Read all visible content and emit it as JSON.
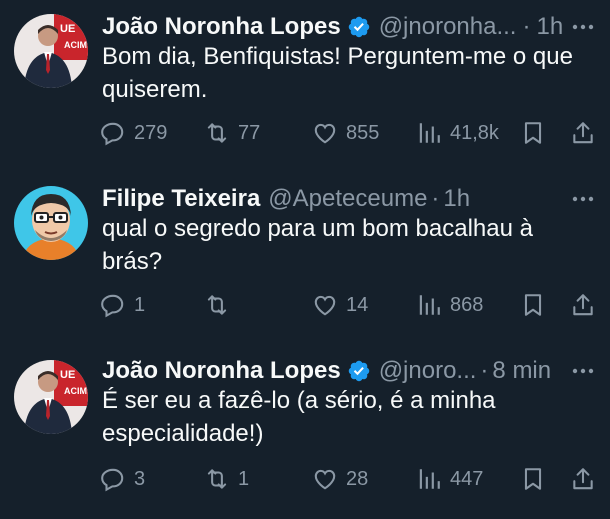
{
  "tweets": [
    {
      "author_name": "João Noronha Lopes",
      "verified": true,
      "handle": "@jnoronha...",
      "dot": "·",
      "time": "1h",
      "text": "Bom dia, Benfiquistas! Perguntem-me o que quiserem.",
      "replies": "279",
      "retweets": "77",
      "likes": "855",
      "views": "41,8k"
    },
    {
      "author_name": "Filipe Teixeira",
      "verified": false,
      "handle": "@Apeteceume",
      "dot": "·",
      "time": "1h",
      "text": "qual o segredo para um bom bacalhau à brás?",
      "replies": "1",
      "retweets": "",
      "likes": "14",
      "views": "868"
    },
    {
      "author_name": "João Noronha Lopes",
      "verified": true,
      "handle": "@jnoro...",
      "dot": "·",
      "time": "8 min",
      "text": "É ser eu a fazê-lo (a sério, é a minha especialidade!)",
      "replies": "3",
      "retweets": "1",
      "likes": "28",
      "views": "447"
    }
  ],
  "colors": {
    "background": "#15202b",
    "text": "#f7f9f9",
    "secondary": "#8b98a5",
    "verified_blue": "#1d9bf0"
  }
}
